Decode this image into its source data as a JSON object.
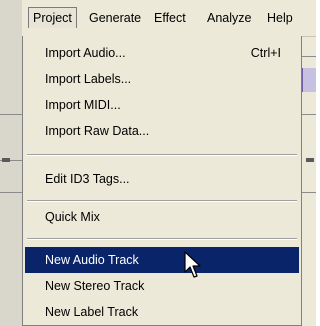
{
  "menubar": {
    "items": [
      {
        "label": "Project",
        "open": true
      },
      {
        "label": "Generate"
      },
      {
        "label": "Effect"
      },
      {
        "label": "Analyze"
      },
      {
        "label": "Help"
      }
    ]
  },
  "menu": {
    "items": [
      {
        "label": "Import Audio...",
        "shortcut": "Ctrl+I"
      },
      {
        "label": "Import Labels..."
      },
      {
        "label": "Import MIDI..."
      },
      {
        "label": "Import Raw Data..."
      },
      {
        "label": "Edit ID3 Tags..."
      },
      {
        "label": "Quick Mix"
      },
      {
        "label": "New Audio Track",
        "selected": true
      },
      {
        "label": "New Stereo Track"
      },
      {
        "label": "New Label Track"
      }
    ]
  },
  "colors": {
    "highlight": "#0a246a",
    "menu_bg": "#ece9d8"
  },
  "icons": {
    "cursor": "mouse-pointer-icon"
  }
}
